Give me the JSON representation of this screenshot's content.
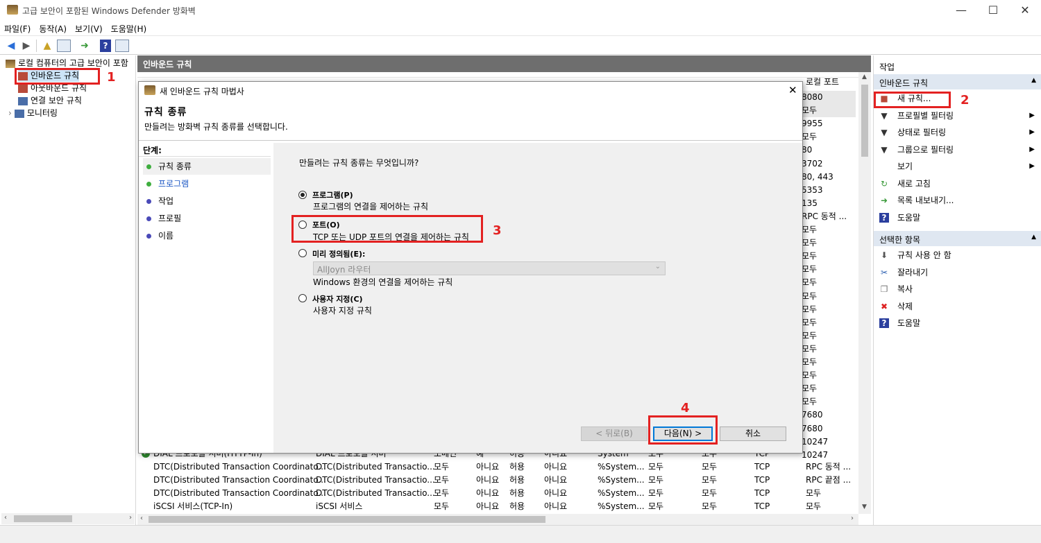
{
  "window": {
    "title": "고급 보안이 포함된 Windows Defender 방화벽",
    "minimize": "—",
    "maximize": "☐",
    "close": "✕"
  },
  "menu": [
    "파일(F)",
    "동작(A)",
    "보기(V)",
    "도움말(H)"
  ],
  "tree": {
    "root": "로컬 컴퓨터의 고급 보안이 포함",
    "items": [
      "인바운드 규칙",
      "아웃바운드 규칙",
      "연결 보안 규칙",
      "모니터링"
    ]
  },
  "center": {
    "header": "인바운드 규칙",
    "local_port_header": "로컬 포트",
    "local_ports": [
      "8080",
      "모두",
      "9955",
      "모두",
      "80",
      "3702",
      "80, 443",
      "5353",
      "135",
      "RPC 동적 ...",
      "모두",
      "모두",
      "모두",
      "모두",
      "모두",
      "모두",
      "모두",
      "모두",
      "모두",
      "모두",
      "모두",
      "모두",
      "모두",
      "모두",
      "7680",
      "7680",
      "10247",
      "10247"
    ],
    "rows": [
      [
        "DIAL 프로토콜 서버(HTTP-In)",
        "DIAL 프로토콜 서버",
        "도메인",
        "예",
        "허용",
        "아니요",
        "System",
        "모두",
        "모두",
        "TCP"
      ],
      [
        "DTC(Distributed Transaction Coordinato...",
        "DTC(Distributed Transactio...",
        "모두",
        "아니요",
        "허용",
        "아니요",
        "%System...",
        "모두",
        "모두",
        "TCP",
        "RPC 동적 ..."
      ],
      [
        "DTC(Distributed Transaction Coordinato...",
        "DTC(Distributed Transactio...",
        "모두",
        "아니요",
        "허용",
        "아니요",
        "%System...",
        "모두",
        "모두",
        "TCP",
        "RPC 끝점 ..."
      ],
      [
        "DTC(Distributed Transaction Coordinato...",
        "DTC(Distributed Transactio...",
        "모두",
        "아니요",
        "허용",
        "아니요",
        "%System...",
        "모두",
        "모두",
        "TCP",
        "모두"
      ],
      [
        "iSCSI 서비스(TCP-In)",
        "iSCSI 서비스",
        "모두",
        "아니요",
        "허용",
        "아니요",
        "%System...",
        "모두",
        "모두",
        "TCP",
        "모두"
      ]
    ]
  },
  "actions": {
    "pane_title": "작업",
    "section1": "인바운드 규칙",
    "items1": [
      {
        "label": "새 규칙...",
        "icon": "new-rule-icon"
      },
      {
        "label": "프로필별 필터링",
        "icon": "filter-icon",
        "submenu": true
      },
      {
        "label": "상태로 필터링",
        "icon": "filter-icon",
        "submenu": true
      },
      {
        "label": "그룹으로 필터링",
        "icon": "filter-icon",
        "submenu": true
      },
      {
        "label": "보기",
        "icon": "",
        "submenu": true
      },
      {
        "label": "새로 고침",
        "icon": "refresh-icon"
      },
      {
        "label": "목록 내보내기...",
        "icon": "export-icon"
      },
      {
        "label": "도움말",
        "icon": "help-icon"
      }
    ],
    "section2": "선택한 항목",
    "items2": [
      {
        "label": "규칙 사용 안 함",
        "icon": "disable-icon"
      },
      {
        "label": "잘라내기",
        "icon": "cut-icon"
      },
      {
        "label": "복사",
        "icon": "copy-icon"
      },
      {
        "label": "삭제",
        "icon": "delete-icon"
      },
      {
        "label": "도움말",
        "icon": "help-icon"
      }
    ]
  },
  "dialog": {
    "title": "새 인바운드 규칙 마법사",
    "heading": "규칙 종류",
    "subheading": "만들려는 방화벽 규칙 종류를 선택합니다.",
    "steps_title": "단계:",
    "steps": [
      "규칙 종류",
      "프로그램",
      "작업",
      "프로필",
      "이름"
    ],
    "question": "만들려는 규칙 종류는 무엇입니까?",
    "options": [
      {
        "label": "프로그램(P)",
        "desc": "프로그램의 연결을 제어하는 규칙",
        "checked": true
      },
      {
        "label": "포트(O)",
        "desc": "TCP 또는 UDP 포트의 연결을 제어하는 규칙",
        "checked": false
      },
      {
        "label": "미리 정의됨(E):",
        "desc": "Windows 환경의 연결을 제어하는 규칙",
        "checked": false,
        "dropdown": "AllJoyn 라우터"
      },
      {
        "label": "사용자 지정(C)",
        "desc": "사용자 지정 규칙",
        "checked": false
      }
    ],
    "back": "< 뒤로(B)",
    "next": "다음(N) >",
    "cancel": "취소"
  },
  "annotations": [
    "1",
    "2",
    "3",
    "4"
  ],
  "colors": {
    "annotation": "#e32121",
    "header": "#6e6e6e",
    "section": "#dfe7f1"
  }
}
